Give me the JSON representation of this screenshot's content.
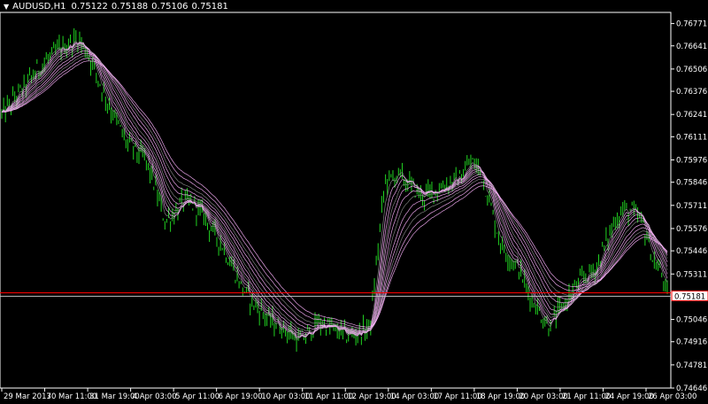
{
  "header": {
    "menu_icon": "triangle-down-icon",
    "symbol": "AUDUSD,H1",
    "open": "0.75122",
    "high": "0.75188",
    "low": "0.75106",
    "close": "0.75181"
  },
  "colors": {
    "background": "#000000",
    "axis": "#ffffff",
    "candles": "#21d321",
    "ma_light": "#ffb3ff",
    "ma_dark": "#8b8b8b",
    "bid_line": "#ff0000",
    "ask_line": "#c0c0c0",
    "price_label_bg": "#ffffff",
    "price_label_text": "#000000",
    "price_label_border": "#ff0000"
  },
  "chart_data": {
    "type": "candlestick",
    "symbol": "AUDUSD",
    "timeframe": "H1",
    "y_ticks": [
      "0.76771",
      "0.76641",
      "0.76506",
      "0.76376",
      "0.76241",
      "0.76111",
      "0.75976",
      "0.75846",
      "0.75711",
      "0.75576",
      "0.75446",
      "0.75311",
      "0.75046",
      "0.74916",
      "0.74781",
      "0.74646"
    ],
    "ylim": [
      0.74646,
      0.76836
    ],
    "current_price_label": "0.75181",
    "current_price": 0.75181,
    "bid_line": 0.75201,
    "x_ticks": [
      "29 Mar 2017",
      "30 Mar 11:00",
      "31 Mar 19:00",
      "4 Apr 03:00",
      "5 Apr 11:00",
      "6 Apr 19:00",
      "10 Apr 03:00",
      "11 Apr 11:00",
      "12 Apr 19:00",
      "14 Apr 03:00",
      "17 Apr 11:00",
      "18 Apr 19:00",
      "20 Apr 03:00",
      "21 Apr 11:00",
      "24 Apr 19:00",
      "26 Apr 03:00"
    ],
    "price_path": [
      [
        0,
        0.7624
      ],
      [
        4,
        0.7638
      ],
      [
        8,
        0.7652
      ],
      [
        12,
        0.7662
      ],
      [
        14,
        0.7665
      ],
      [
        16,
        0.7668
      ],
      [
        18,
        0.766
      ],
      [
        22,
        0.7632
      ],
      [
        26,
        0.7608
      ],
      [
        30,
        0.7598
      ],
      [
        32,
        0.7582
      ],
      [
        34,
        0.7562
      ],
      [
        36,
        0.7566
      ],
      [
        38,
        0.7574
      ],
      [
        40,
        0.7571
      ],
      [
        42,
        0.7566
      ],
      [
        44,
        0.7556
      ],
      [
        46,
        0.7548
      ],
      [
        48,
        0.7536
      ],
      [
        50,
        0.7524
      ],
      [
        52,
        0.7516
      ],
      [
        56,
        0.7504
      ],
      [
        60,
        0.7497
      ],
      [
        62,
        0.7492
      ],
      [
        64,
        0.7496
      ],
      [
        66,
        0.7503
      ],
      [
        68,
        0.7501
      ],
      [
        70,
        0.7498
      ],
      [
        72,
        0.7495
      ],
      [
        74,
        0.7496
      ],
      [
        76,
        0.7498
      ],
      [
        77,
        0.7502
      ],
      [
        80,
        0.7585
      ],
      [
        83,
        0.7589
      ],
      [
        86,
        0.7581
      ],
      [
        88,
        0.7576
      ],
      [
        92,
        0.7582
      ],
      [
        96,
        0.7588
      ],
      [
        98,
        0.7597
      ],
      [
        100,
        0.7591
      ],
      [
        102,
        0.7572
      ],
      [
        104,
        0.755
      ],
      [
        106,
        0.7541
      ],
      [
        108,
        0.7534
      ],
      [
        110,
        0.752
      ],
      [
        112,
        0.751
      ],
      [
        114,
        0.7501
      ],
      [
        116,
        0.7507
      ],
      [
        118,
        0.7516
      ],
      [
        120,
        0.7524
      ],
      [
        122,
        0.753
      ],
      [
        124,
        0.7534
      ],
      [
        126,
        0.7548
      ],
      [
        128,
        0.7562
      ],
      [
        130,
        0.7569
      ],
      [
        132,
        0.7567
      ],
      [
        134,
        0.756
      ],
      [
        136,
        0.7539
      ],
      [
        138,
        0.753
      ],
      [
        139,
        0.7518
      ]
    ],
    "moving_average_fan": "multi-line MA ribbon in pink and gray tracking price"
  }
}
